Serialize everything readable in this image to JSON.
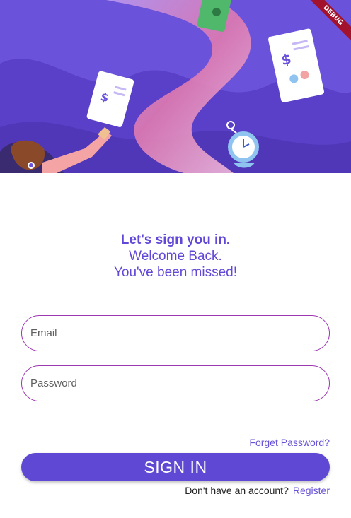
{
  "hero": {
    "illustration": "finance-illustration",
    "debug_label": "DEBUG"
  },
  "heading": {
    "line1": "Let's sign you in.",
    "line2": "Welcome Back.",
    "line3": "You've been missed!"
  },
  "form": {
    "email_placeholder": "Email",
    "password_placeholder": "Password",
    "forgot_label": "Forget Password?",
    "signin_label": "SIGN IN",
    "no_account_label": "Don't have an account?",
    "register_label": "Register"
  },
  "colors": {
    "accent": "#5f48d3",
    "field_border": "#9c37b0",
    "hero_bg": "#6750d8"
  }
}
